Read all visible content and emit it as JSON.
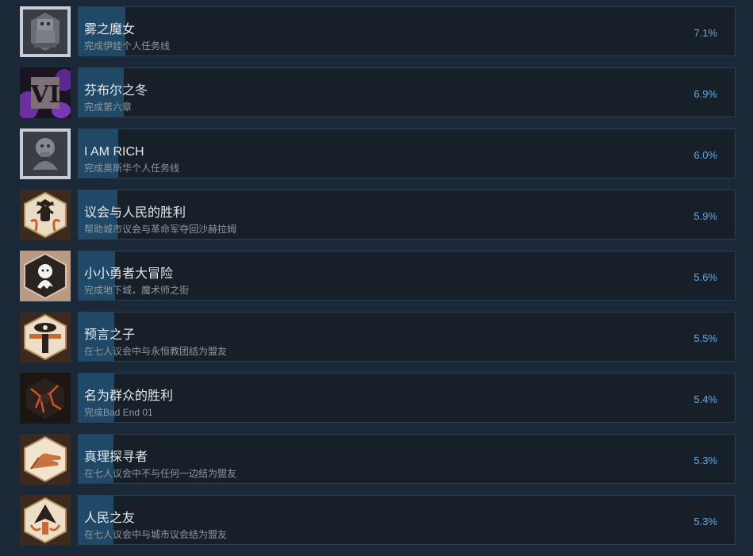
{
  "achievements": [
    {
      "title": "雾之魔女",
      "description": "完成伊娃个人任务线",
      "percent_text": "7.1%",
      "percent": 7.1,
      "icon": "stone-knight-icon"
    },
    {
      "title": "芬布尔之冬",
      "description": "完成第六章",
      "percent_text": "6.9%",
      "percent": 6.9,
      "icon": "roman-six-icon"
    },
    {
      "title": "I AM RICH",
      "description": "完成奥斯华个人任务线",
      "percent_text": "6.0%",
      "percent": 6.0,
      "icon": "stone-bust-icon"
    },
    {
      "title": "议会与人民的胜利",
      "description": "帮助城市议会与革命军夺回沙赫拉姆",
      "percent_text": "5.9%",
      "percent": 5.9,
      "icon": "raised-fist-badge-icon"
    },
    {
      "title": "小小勇者大冒险",
      "description": "完成地下城，魔术师之街",
      "percent_text": "5.6%",
      "percent": 5.6,
      "icon": "little-ghost-icon"
    },
    {
      "title": "预言之子",
      "description": "在七人议会中与永恒教团结为盟友",
      "percent_text": "5.5%",
      "percent": 5.5,
      "icon": "eye-pillar-badge-icon"
    },
    {
      "title": "名为群众的胜利",
      "description": "完成Bad End 01",
      "percent_text": "5.4%",
      "percent": 5.4,
      "icon": "cracked-lava-icon"
    },
    {
      "title": "真理探寻者",
      "description": "在七人议会中不与任何一边结为盟友",
      "percent_text": "5.3%",
      "percent": 5.3,
      "icon": "open-hand-badge-icon"
    },
    {
      "title": "人民之友",
      "description": "在七人议会中与城市议会结为盟友",
      "percent_text": "5.3%",
      "percent": 5.3,
      "icon": "pointed-shield-badge-icon"
    }
  ],
  "colors": {
    "background": "#1b2838",
    "bar": "#171f29",
    "bar_fill": "#1f4966",
    "title": "#e5e9ee",
    "description": "#8f98a0",
    "percent": "#5fa9ea"
  }
}
